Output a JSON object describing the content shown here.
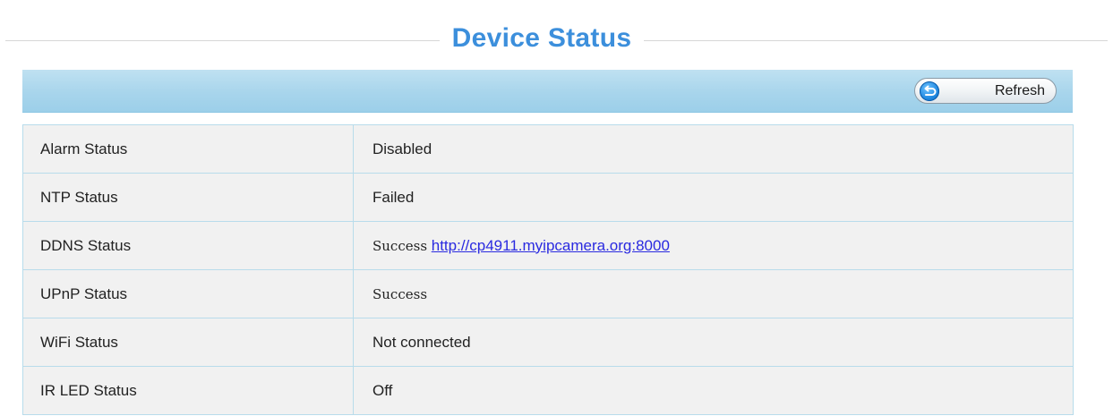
{
  "page": {
    "title": "Device Status"
  },
  "toolbar": {
    "refresh_label": "Refresh"
  },
  "status_rows": [
    {
      "label": "Alarm Status",
      "value": "Disabled"
    },
    {
      "label": "NTP Status",
      "value": "Failed"
    },
    {
      "label": "DDNS Status",
      "value": "Success",
      "link": "http://cp4911.myipcamera.org:8000"
    },
    {
      "label": "UPnP Status",
      "value": "Success"
    },
    {
      "label": "WiFi Status",
      "value": "Not connected"
    },
    {
      "label": "IR LED Status",
      "value": "Off"
    }
  ],
  "colors": {
    "title": "#3c8fdc",
    "toolbar": "#a8d5ec",
    "link": "#2a2ae0",
    "table_bg": "#f1f1f1",
    "table_border": "#b8dceb"
  },
  "icons": {
    "refresh": "refresh-icon"
  }
}
